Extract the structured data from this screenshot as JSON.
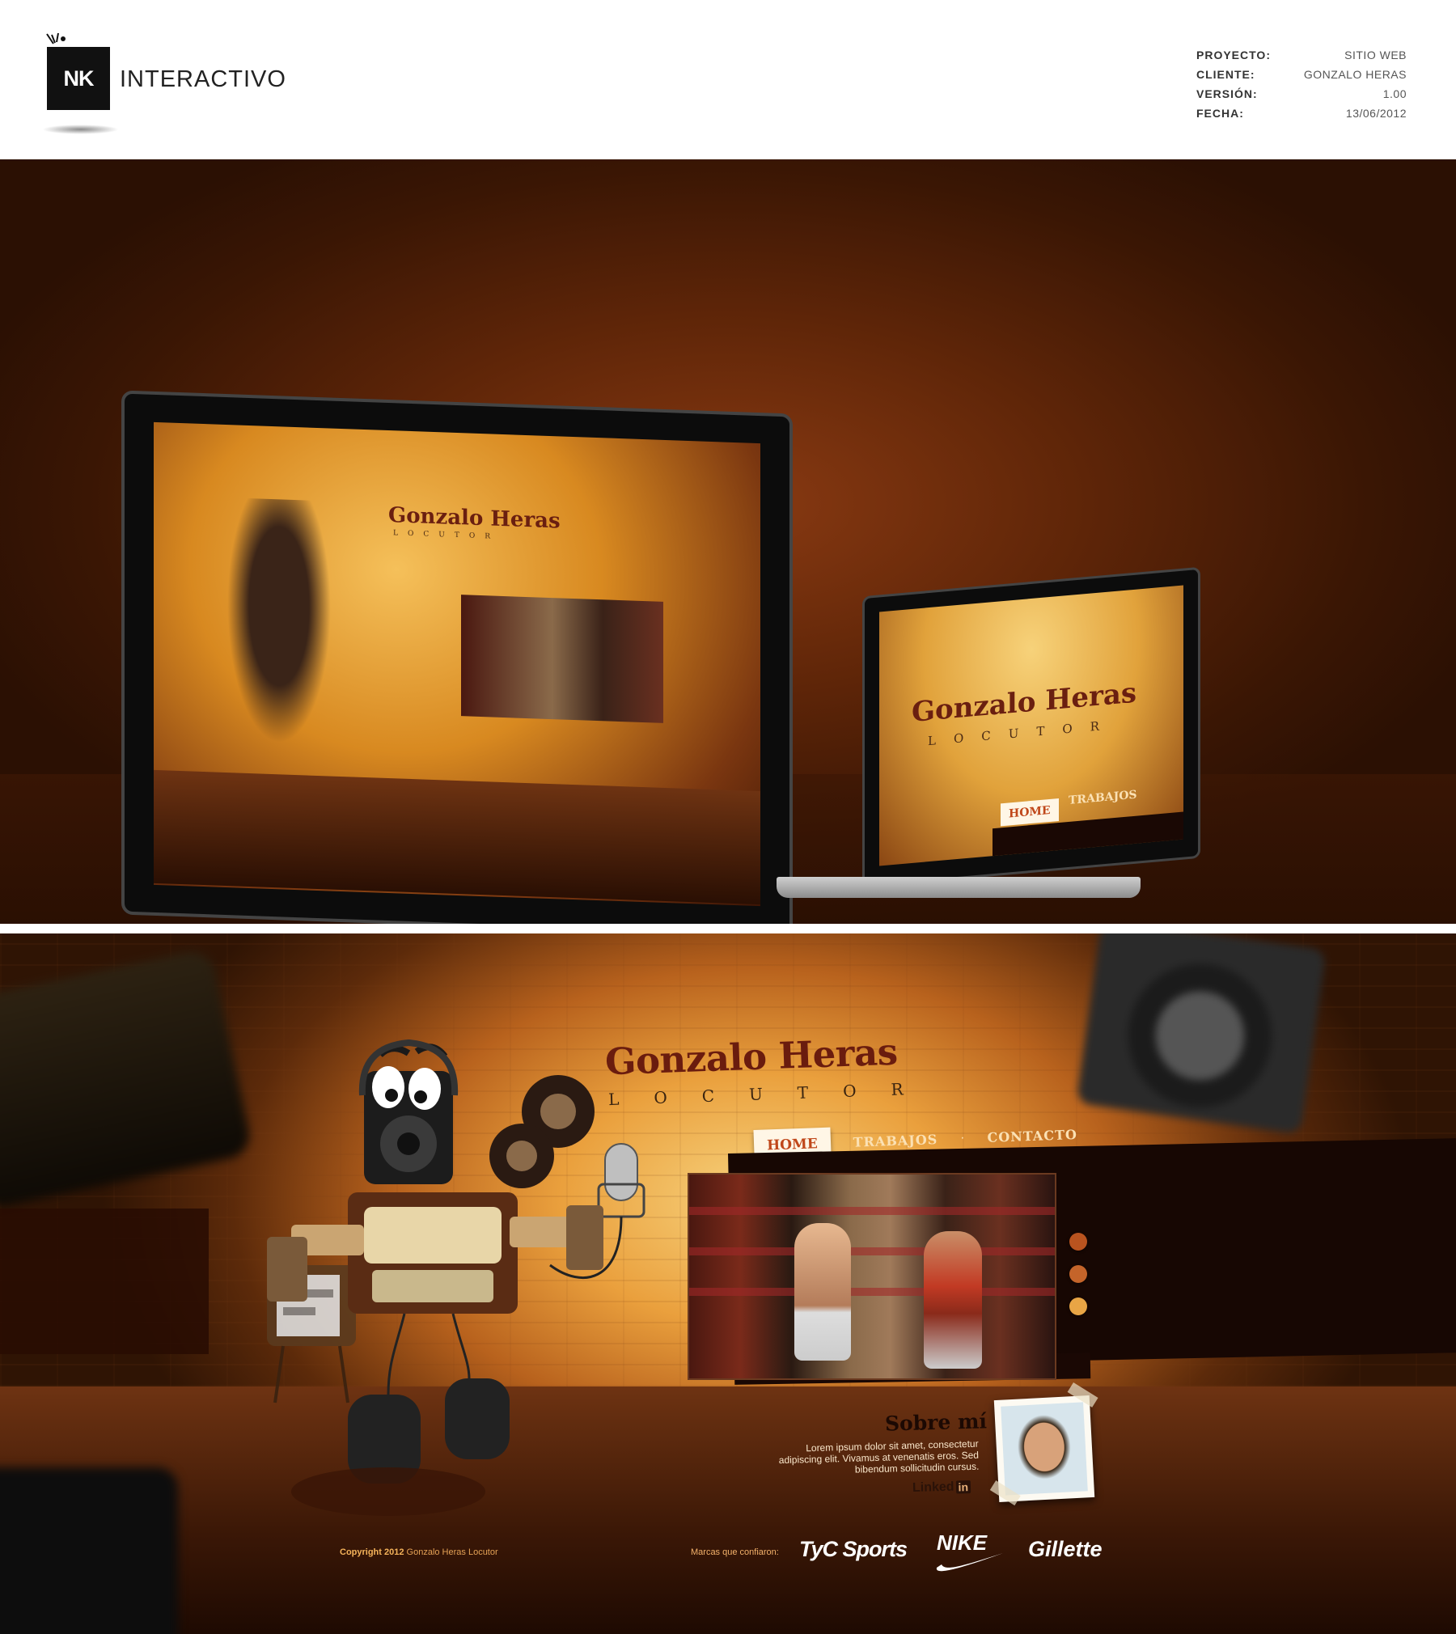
{
  "header": {
    "logo_mark": "NK",
    "logo_text": "INTERACTIVO",
    "meta": [
      {
        "key": "PROYECTO:",
        "value": "SITIO WEB"
      },
      {
        "key": "CLIENTE:",
        "value": "GONZALO HERAS"
      },
      {
        "key": "VERSIÓN:",
        "value": "1.00"
      },
      {
        "key": "FECHA:",
        "value": "13/06/2012"
      }
    ]
  },
  "site": {
    "title": "Gonzalo Heras",
    "subtitle": "LOCUTOR",
    "nav": [
      {
        "label": "HOME",
        "active": true
      },
      {
        "label": "TRABAJOS",
        "active": false
      },
      {
        "label": "CONTACTO",
        "active": false
      }
    ],
    "nav_separator": "·",
    "video_dots": [
      {
        "color": "#b9531f"
      },
      {
        "color": "#c4642a"
      },
      {
        "color": "#e9a545"
      }
    ],
    "about": {
      "heading": "Sobre mí",
      "text": "Lorem ipsum dolor sit amet, consectetur adipiscing elit. Vivamus at venenatis eros. Sed bibendum sollicitudin cursus.",
      "linkedin_word": "Linked",
      "linkedin_in": "in"
    },
    "footer": {
      "copyright_bold": "Copyright 2012",
      "copyright_rest": "Gonzalo Heras Locutor",
      "brands_label": "Marcas que confiaron:",
      "brands": [
        "TyC Sports",
        "NIKE",
        "Gillette"
      ]
    }
  },
  "colors": {
    "title": "#6a1c0e",
    "nav_active_bg": "#fff6e6",
    "nav_active_text": "#c0471a",
    "nav_text": "#fbe1b4",
    "background_dark": "#2f1404"
  },
  "icons": [
    "linkedin-icon",
    "nike-swoosh-icon",
    "robot-mascot-icon",
    "microphone-icon",
    "speaker-icon"
  ]
}
